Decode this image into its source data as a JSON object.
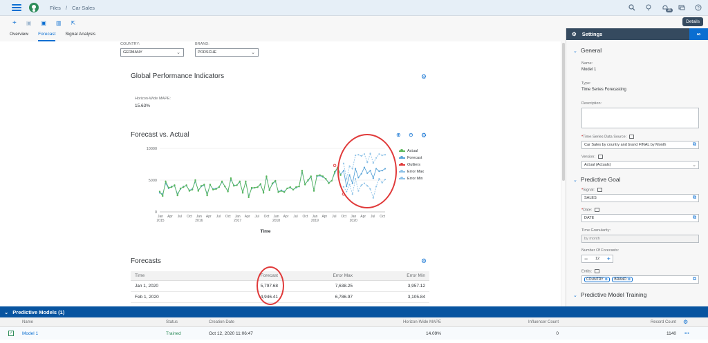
{
  "shell": {
    "breadcrumb_root": "Files",
    "breadcrumb_sep": "/",
    "breadcrumb_current": "Car Sales",
    "notification_count": "15"
  },
  "toolbar": {
    "details_label": "Details"
  },
  "tabs": [
    {
      "label": "Overview"
    },
    {
      "label": "Forecast"
    },
    {
      "label": "Signal Analysis"
    }
  ],
  "filters": {
    "country_label": "COUNTRY:",
    "country_value": "GERMANY",
    "brand_label": "BRAND:",
    "brand_value": "PORSCHE"
  },
  "gpi": {
    "title": "Global Performance Indicators",
    "kpi_label": "Horizon-Wide MAPE:",
    "kpi_value": "15.63%"
  },
  "chart_section": {
    "title": "Forecast vs. Actual"
  },
  "chart_data": {
    "type": "line",
    "title": "",
    "xlabel": "Time",
    "ylabel": "",
    "ylim": [
      0,
      10000
    ],
    "yticks": [
      "0",
      "5000",
      "10000"
    ],
    "x_month_labels": [
      "Jan",
      "Apr",
      "Jul",
      "Oct",
      "Jan",
      "Apr",
      "Jul",
      "Oct",
      "Jan",
      "Apr",
      "Jul",
      "Oct",
      "Jan",
      "Apr",
      "Jul",
      "Oct",
      "Jan",
      "Apr",
      "Jul",
      "Oct",
      "Jan",
      "Apr",
      "Jul",
      "Oct"
    ],
    "x_year_labels": [
      "2015",
      "2016",
      "2017",
      "2018",
      "2019",
      "2020"
    ],
    "legend": [
      "Actual",
      "Forecast",
      "Outliers",
      "Error Max",
      "Error Min"
    ],
    "colors": {
      "Actual": "#5cb85c",
      "Forecast": "#5aa4d8",
      "Outliers": "#e03a3a",
      "Error Max": "#8fc3e8",
      "Error Min": "#8fc3e8"
    },
    "series": [
      {
        "name": "Actual",
        "values": [
          3200,
          2500,
          4800,
          3800,
          3900,
          4200,
          2600,
          3700,
          3900,
          4200,
          3300,
          3500,
          5000,
          3300,
          4100,
          4300,
          2600,
          4300,
          3500,
          3600,
          3900,
          4800,
          4000,
          3200,
          5300,
          4100,
          4200,
          4800,
          3000,
          4800,
          2300,
          3800,
          3800,
          3900,
          4400,
          3000,
          5600,
          3400,
          4500,
          4900,
          3100,
          3300,
          3100,
          3700,
          3900,
          3500,
          3900,
          4000,
          6500,
          4300,
          5000,
          5600,
          3300,
          5700,
          5800,
          5600,
          5200,
          4500,
          4900,
          6300,
          7000,
          5800
        ]
      },
      {
        "name": "Forecast",
        "values": [
          3000,
          2800,
          4500,
          3700,
          4000,
          4100,
          2800,
          3600,
          4000,
          4100,
          3400,
          3600,
          4800,
          3400,
          4000,
          4200,
          2800,
          4200,
          3600,
          3700,
          3900,
          4700,
          4000,
          3300,
          5100,
          4200,
          4200,
          4700,
          3100,
          4700,
          2500,
          3700,
          3800,
          3900,
          4300,
          3100,
          5400,
          3500,
          4400,
          4800,
          3200,
          3400,
          3200,
          3700,
          3800,
          3500,
          3800,
          4000,
          6300,
          4400,
          4900,
          5500,
          3400,
          5600,
          5700,
          5500,
          5200,
          4600,
          4900,
          6100,
          6900,
          5900,
          6500,
          4000,
          5800,
          4500,
          6800,
          5400,
          6000,
          7000,
          6100,
          6500,
          5300,
          6800,
          6400,
          6500,
          6800
        ]
      },
      {
        "name": "Error Max",
        "values": [
          null,
          null,
          null,
          null,
          null,
          null,
          null,
          null,
          null,
          null,
          null,
          null,
          null,
          null,
          null,
          null,
          null,
          null,
          null,
          null,
          null,
          null,
          null,
          null,
          null,
          null,
          null,
          null,
          null,
          null,
          null,
          null,
          null,
          null,
          null,
          null,
          null,
          null,
          null,
          null,
          null,
          null,
          null,
          null,
          null,
          null,
          null,
          null,
          null,
          null,
          null,
          null,
          null,
          null,
          null,
          null,
          null,
          null,
          null,
          null,
          null,
          null,
          7638,
          5200,
          7200,
          6800,
          8900,
          9000,
          8800,
          9100,
          7800,
          9200,
          7700,
          8500,
          9100,
          8900,
          9000
        ]
      },
      {
        "name": "Error Min",
        "values": [
          null,
          null,
          null,
          null,
          null,
          null,
          null,
          null,
          null,
          null,
          null,
          null,
          null,
          null,
          null,
          null,
          null,
          null,
          null,
          null,
          null,
          null,
          null,
          null,
          null,
          null,
          null,
          null,
          null,
          null,
          null,
          null,
          null,
          null,
          null,
          null,
          null,
          null,
          null,
          null,
          null,
          null,
          null,
          null,
          null,
          null,
          null,
          null,
          null,
          null,
          null,
          null,
          null,
          null,
          null,
          null,
          null,
          null,
          null,
          null,
          null,
          null,
          3957,
          3200,
          4300,
          2800,
          5200,
          3300,
          4200,
          4500,
          4100,
          3600,
          2200,
          4000,
          5200,
          4600,
          5100
        ]
      },
      {
        "name": "Outliers",
        "points": [
          [
            59,
            7300
          ],
          [
            62,
            2800
          ]
        ]
      }
    ]
  },
  "forecasts": {
    "title": "Forecasts",
    "columns": [
      "Time",
      "Forecast",
      "Error Max",
      "Error Min"
    ],
    "rows": [
      [
        "Jan 1, 2020",
        "5,797.68",
        "7,638.25",
        "3,957.12"
      ],
      [
        "Feb 1, 2020",
        "4,946.41",
        "6,786.97",
        "3,105.84"
      ]
    ]
  },
  "settings": {
    "header": "Settings",
    "general_title": "General",
    "name_label": "Name:",
    "name_value": "Model 1",
    "type_label": "Type:",
    "type_value": "Time Series Forecasting",
    "description_label": "Description:",
    "source_label": "Time-Series Data Source:",
    "source_value": "Car Sales by country and brand FINAL by Month",
    "version_label": "Version:",
    "version_value": "Actual (Actuals)",
    "goal_title": "Predictive Goal",
    "signal_label": "Signal:",
    "signal_value": "SALES",
    "date_label": "Date:",
    "date_value": "DATE",
    "granularity_label": "Time Granularity:",
    "granularity_value": "by month",
    "nforecasts_label": "Number Of Forecasts:",
    "nforecasts_value": "12",
    "entity_label": "Entity:",
    "entity_tokens": [
      "COUNTRY",
      "BRAND"
    ],
    "training_title": "Predictive Model Training"
  },
  "models": {
    "header": "Predictive Models (1)",
    "columns": [
      "Name",
      "Status",
      "Creation Date",
      "Horizon-Wide MAPE",
      "Influencer Count",
      "Record Count"
    ],
    "row": {
      "name": "Model 1",
      "status": "Trained",
      "created": "Oct 12, 2020 11:06:47",
      "mape": "14.09%",
      "influencers": "0",
      "records": "1140"
    }
  }
}
